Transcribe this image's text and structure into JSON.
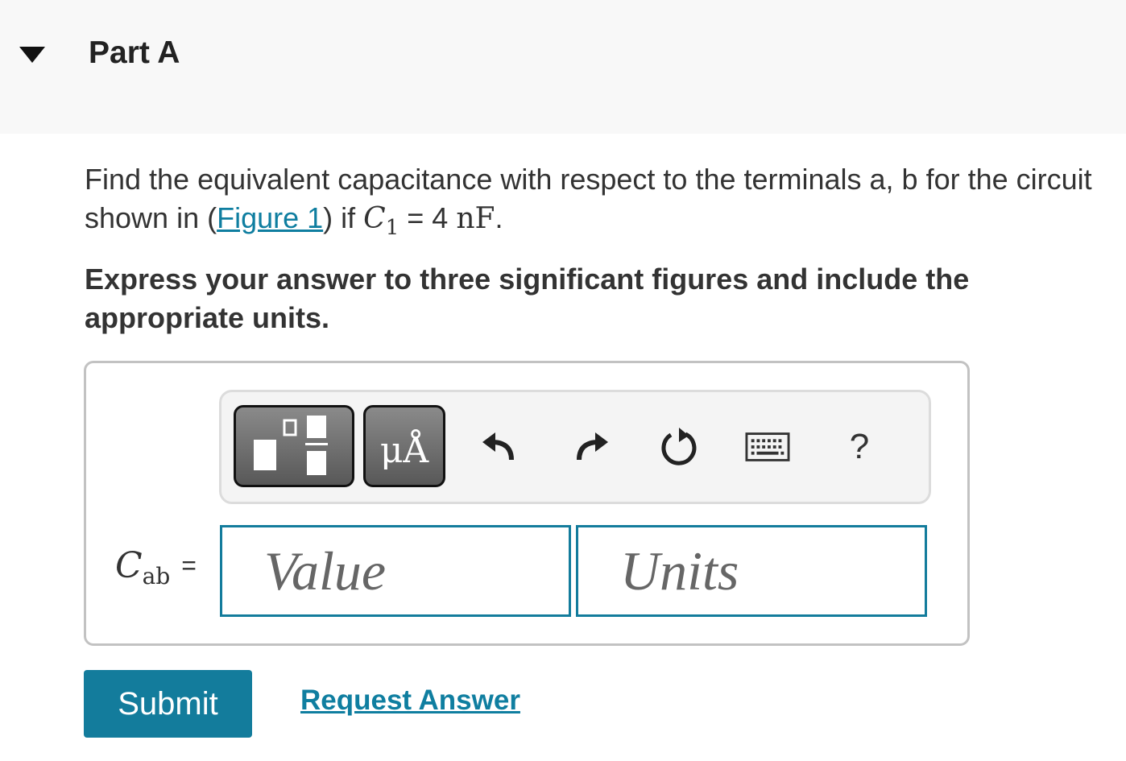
{
  "header": {
    "toggle_icon": "triangle-down-icon",
    "title": "Part A"
  },
  "question": {
    "text_before": "Find the equivalent capacitance with respect to the terminals a, b for the circuit shown in (",
    "figure_link": "Figure 1",
    "text_after": ") if ",
    "var": "C",
    "var_sub": "1",
    "equals_value": " = 4 ",
    "unit": "nF",
    "period": "."
  },
  "instruction": "Express your answer to three significant figures and include the appropriate units.",
  "toolbar": {
    "templates_icon": "templates-icon",
    "units_label": "μÅ",
    "undo_icon": "undo-icon",
    "redo_icon": "redo-icon",
    "reset_icon": "reset-icon",
    "keyboard_icon": "keyboard-icon",
    "help_label": "?"
  },
  "answer": {
    "label_var": "C",
    "label_sub": "ab",
    "label_eq": "=",
    "value_placeholder": "Value",
    "units_placeholder": "Units"
  },
  "actions": {
    "submit_label": "Submit",
    "request_label": "Request Answer"
  },
  "colors": {
    "accent": "#137c9c",
    "link": "#0f7ea0",
    "header_bg": "#f8f8f8"
  }
}
